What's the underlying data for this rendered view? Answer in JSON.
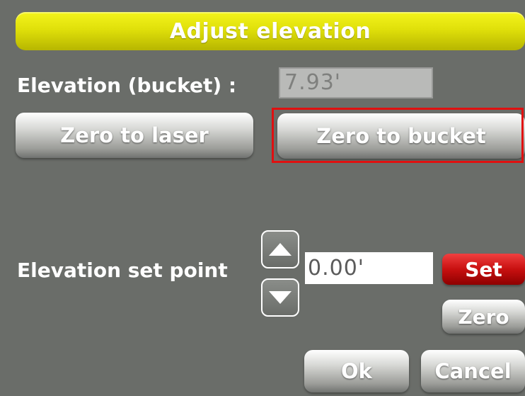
{
  "title": "Adjust elevation",
  "elevation_bucket": {
    "label": "Elevation (bucket) :",
    "value": "7.93'"
  },
  "buttons": {
    "zero_to_laser": "Zero to laser",
    "zero_to_bucket": "Zero to bucket",
    "set": "Set",
    "zero": "Zero",
    "ok": "Ok",
    "cancel": "Cancel"
  },
  "set_point": {
    "label": "Elevation set point",
    "value": "0.00'"
  },
  "icons": {
    "increment": "triangle-up-icon",
    "decrement": "triangle-down-icon"
  },
  "colors": {
    "background": "#6a6d69",
    "title_bar": "#e0e00a",
    "set_button": "#c81010",
    "highlight": "#e01010"
  }
}
